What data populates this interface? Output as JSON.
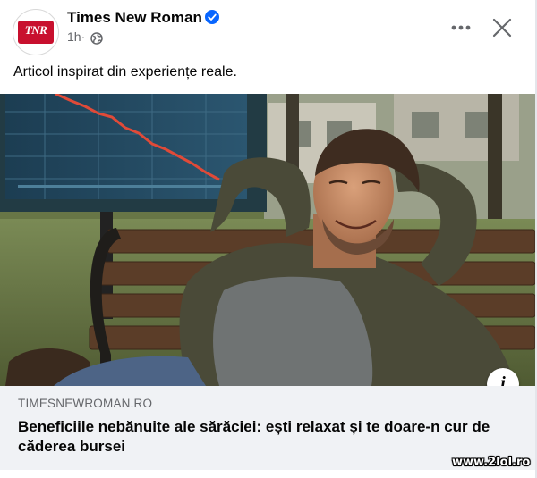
{
  "post": {
    "page_name": "Times New Roman",
    "avatar_logo_text": "TNR",
    "time": "1h",
    "separator": "·",
    "caption": "Articol inspirat din experiențe reale.",
    "link_domain": "TIMESNEWROMAN.RO",
    "link_headline": "Beneficiile nebănuite ale sărăciei: ești relaxat și te doare-n cur de căderea bursei",
    "info_glyph": "i"
  },
  "watermark": "www.2lol.ro",
  "icons": {
    "verified": "verified-badge-icon",
    "globe": "globe-icon",
    "more": "more-options-icon",
    "close": "close-icon",
    "info": "info-icon"
  },
  "colors": {
    "brand_red": "#c8102e",
    "verified_blue": "#0866ff",
    "secondary_text": "#65676b",
    "link_box_bg": "#f0f2f5"
  }
}
